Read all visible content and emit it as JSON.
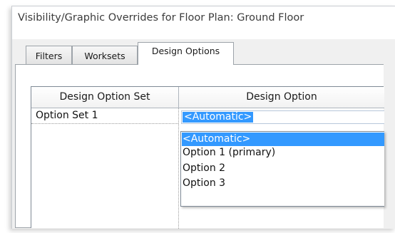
{
  "window": {
    "title": "Visibility/Graphic Overrides for Floor Plan: Ground Floor"
  },
  "tabs": [
    {
      "label": "Filters"
    },
    {
      "label": "Worksets"
    },
    {
      "label": "Design Options",
      "active": true
    }
  ],
  "table": {
    "columns": [
      "Design Option Set",
      "Design Option"
    ],
    "rows": [
      {
        "set": "Option Set 1",
        "option": "<Automatic>"
      }
    ]
  },
  "dropdown": {
    "selected": "<Automatic>",
    "options": [
      "<Automatic>",
      "Option 1 (primary)",
      "Option 2",
      "Option 3"
    ]
  },
  "colors": {
    "selection": "#3399ff",
    "dialog_bg": "#f0f0f0",
    "border": "#9da3a9"
  }
}
